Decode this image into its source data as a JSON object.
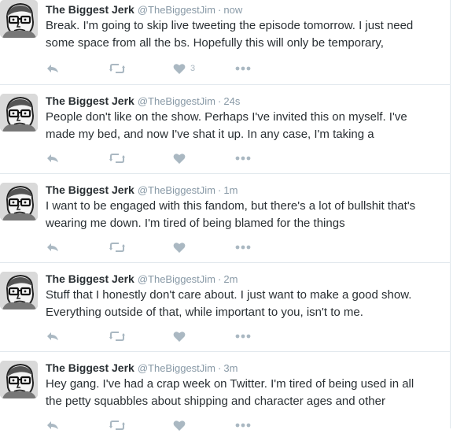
{
  "tweets": [
    {
      "fullname": "The Biggest Jerk",
      "username": "@TheBiggestJim",
      "separator": "·",
      "time": "now",
      "text_line_1": "Break. I'm going to skip live tweeting the episode tomorrow. I just need",
      "text_line_2": "some space from all the bs. Hopefully this will only be temporary,",
      "like_count": "3"
    },
    {
      "fullname": "The Biggest Jerk",
      "username": "@TheBiggestJim",
      "separator": "·",
      "time": "24s",
      "text_line_1": "People don't like on the show. Perhaps I've invited this on myself. I've",
      "text_line_2": "made my bed, and now I've shat it up. In any case, I'm taking a",
      "like_count": ""
    },
    {
      "fullname": "The Biggest Jerk",
      "username": "@TheBiggestJim",
      "separator": "·",
      "time": "1m",
      "text_line_1": "I want to be engaged with this fandom, but there's a lot of bullshit that's",
      "text_line_2": "wearing me down. I'm tired of being blamed for the things",
      "like_count": ""
    },
    {
      "fullname": "The Biggest Jerk",
      "username": "@TheBiggestJim",
      "separator": "·",
      "time": "2m",
      "text_line_1": "Stuff that I honestly don't care about. I just want to make a good show.",
      "text_line_2": "Everything outside of that, while important to you, isn't to me.",
      "like_count": ""
    },
    {
      "fullname": "The Biggest Jerk",
      "username": "@TheBiggestJim",
      "separator": "·",
      "time": "3m",
      "text_line_1": "Hey gang. I've had a crap week on Twitter. I'm tired of being used in all",
      "text_line_2": "the petty squabbles about shipping and character ages and other",
      "like_count": ""
    }
  ],
  "icons": {
    "reply": "reply-icon",
    "retweet": "retweet-icon",
    "like": "heart-icon",
    "more": "more-icon"
  },
  "colors": {
    "text": "#292f33",
    "muted": "#8899a6",
    "action_icon": "#aab8c2",
    "divider": "#e1e8ed"
  }
}
